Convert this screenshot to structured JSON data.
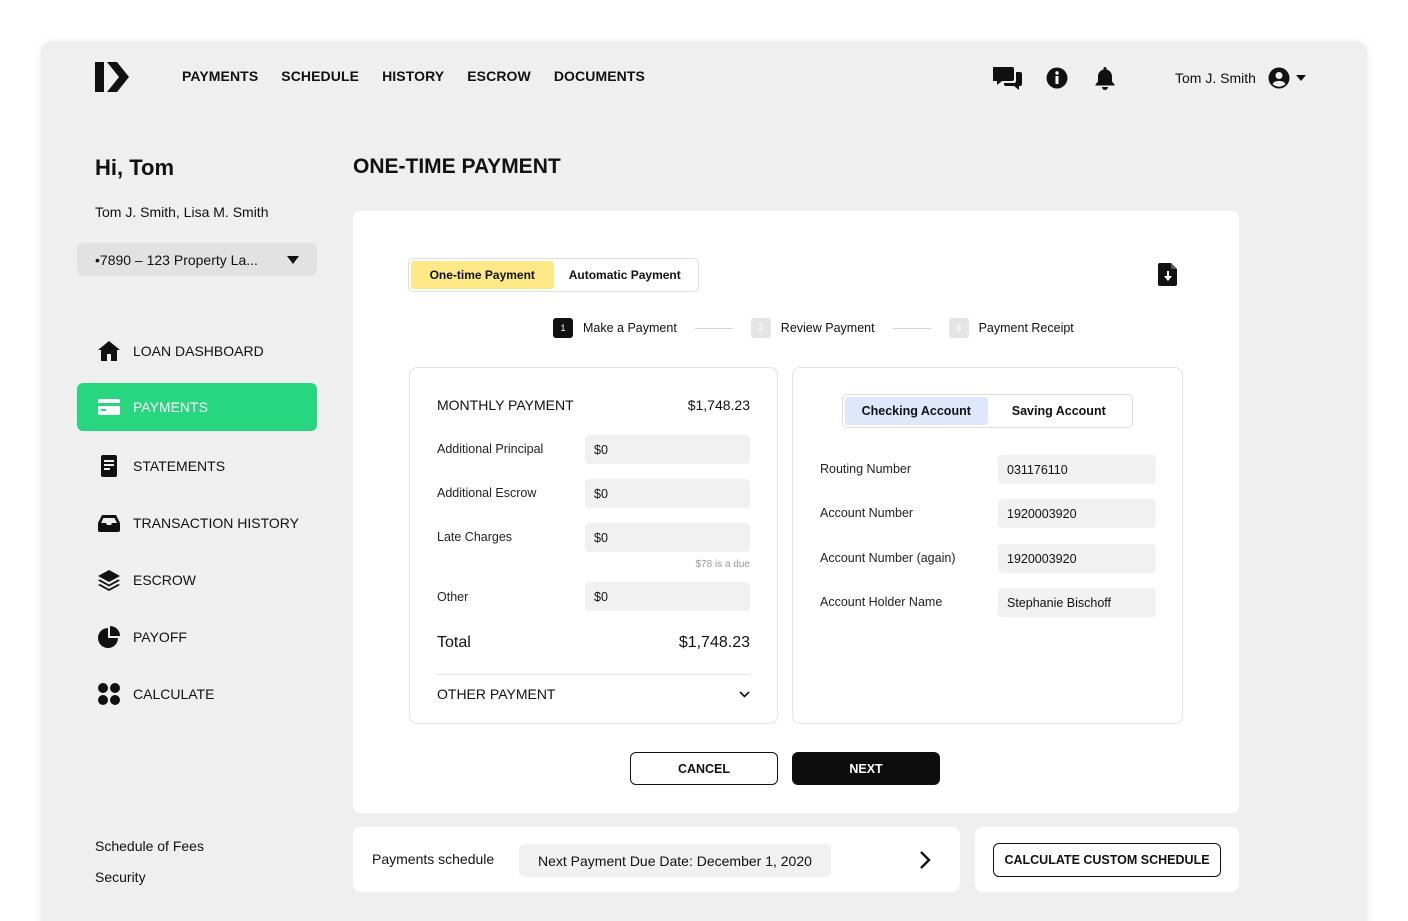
{
  "header": {
    "nav": [
      "PAYMENTS",
      "SCHEDULE",
      "HISTORY",
      "ESCROW",
      "DOCUMENTS"
    ],
    "user_name": "Tom J. Smith",
    "icons": [
      "chat-icon",
      "info-icon",
      "bell-icon",
      "user-icon",
      "caret-down-icon"
    ]
  },
  "sidebar": {
    "greeting": "Hi, Tom",
    "borrowers": "Tom J. Smith, Lisa M. Smith",
    "property_select": "•7890 – 123 Property La...",
    "items": [
      {
        "label": "LOAN DASHBOARD",
        "icon": "home-icon"
      },
      {
        "label": "PAYMENTS",
        "icon": "card-icon",
        "active": true
      },
      {
        "label": "STATEMENTS",
        "icon": "document-icon"
      },
      {
        "label": "TRANSACTION HISTORY",
        "icon": "inbox-icon"
      },
      {
        "label": "ESCROW",
        "icon": "layers-icon"
      },
      {
        "label": "PAYOFF",
        "icon": "pie-icon"
      },
      {
        "label": "CALCULATE",
        "icon": "grid-icon"
      }
    ],
    "footer_links": [
      "Schedule of Fees",
      "Security"
    ]
  },
  "main": {
    "title": "ONE-TIME PAYMENT",
    "payment_type_toggle": [
      "One-time Payment",
      "Automatic Payment"
    ],
    "steps": [
      {
        "num": "1",
        "label": "Make a Payment",
        "active": true
      },
      {
        "num": "2",
        "label": "Review Payment"
      },
      {
        "num": "3",
        "label": "Payment Receipt"
      }
    ],
    "left_panel": {
      "monthly_label": "MONTHLY PAYMENT",
      "monthly_value": "$1,748.23",
      "fields": [
        {
          "label": "Additional Principal",
          "value": "$0"
        },
        {
          "label": "Additional Escrow",
          "value": "$0"
        },
        {
          "label": "Late Charges",
          "value": "$0"
        },
        {
          "label": "Other",
          "value": "$0"
        }
      ],
      "late_note": "$78 is a due",
      "total_label": "Total",
      "total_value": "$1,748.23",
      "other_payment": "OTHER PAYMENT"
    },
    "right_panel": {
      "account_tabs": [
        "Checking Account",
        "Saving Account"
      ],
      "fields": [
        {
          "label": "Routing Number",
          "value": "031176110"
        },
        {
          "label": "Account Number",
          "value": "1920003920"
        },
        {
          "label": "Account Number (again)",
          "value": "1920003920"
        },
        {
          "label": "Account Holder Name",
          "value": "Stephanie Bischoff"
        }
      ]
    },
    "cancel": "CANCEL",
    "next": "NEXT"
  },
  "schedule": {
    "label": "Payments schedule",
    "next_due": "Next Payment Due Date: December 1, 2020",
    "custom_button": "CALCULATE CUSTOM SCHEDULE"
  },
  "colors": {
    "accent_green": "#27d67f",
    "toggle_yellow": "#fde986",
    "tab_blue": "#dfe7fb"
  }
}
